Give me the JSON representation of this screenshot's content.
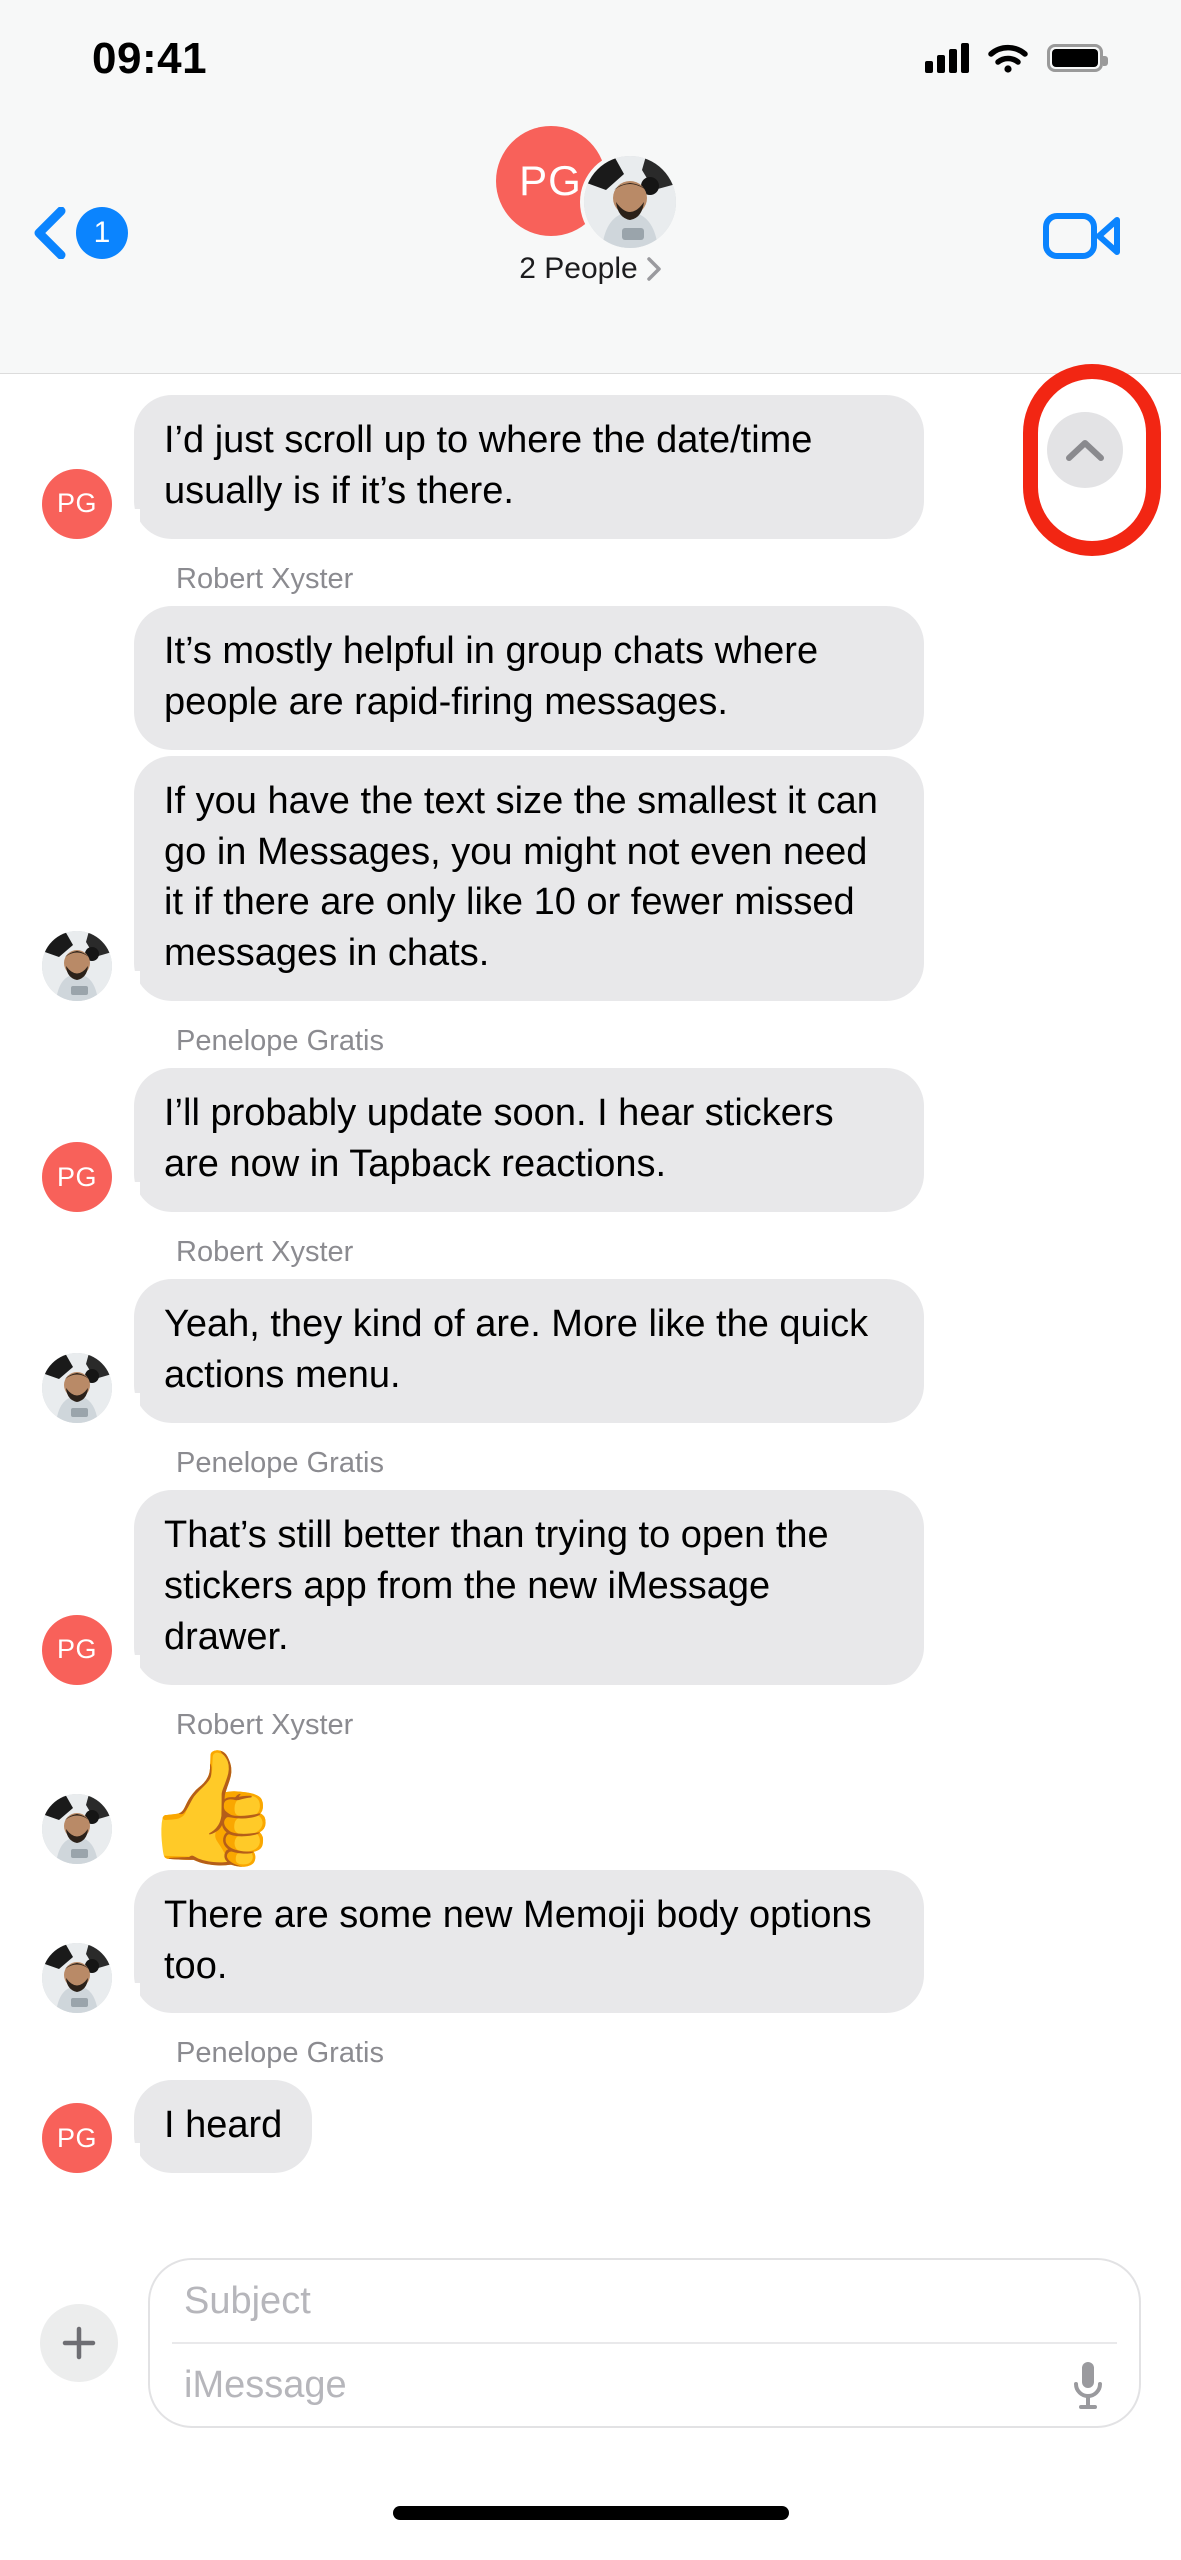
{
  "status_bar": {
    "time": "09:41",
    "cellular_icon": "cellular-signal-icon",
    "wifi_icon": "wifi-icon",
    "battery_icon": "battery-full-icon"
  },
  "nav_bar": {
    "back_icon": "chevron-left-icon",
    "unread_badge": "1",
    "avatar_initials": "PG",
    "avatar_color": "#f8615a",
    "participants_label": "2 People",
    "disclosure_icon": "chevron-right-icon",
    "facetime_icon": "video-camera-icon"
  },
  "scroll_button": {
    "icon": "chevron-up-icon",
    "annotation_color": "#f22613"
  },
  "thread": {
    "messages": [
      {
        "sender": "",
        "show_sender": false,
        "avatar": "PG",
        "avatar_type": "initials",
        "text": "I’d just scroll up to where the date/time usually is if it’s there.",
        "type": "text"
      },
      {
        "sender": "Robert Xyster",
        "show_sender": true,
        "avatar": "",
        "avatar_type": "none",
        "text": "It’s mostly helpful in group chats where people are rapid-firing messages.",
        "type": "text"
      },
      {
        "sender": "",
        "show_sender": false,
        "avatar": "photo",
        "avatar_type": "photo",
        "text": "If you have the text size the smallest it can go in Messages, you might not even need it if there are only like 10 or fewer missed messages in chats.",
        "type": "text"
      },
      {
        "sender": "Penelope Gratis",
        "show_sender": true,
        "avatar": "PG",
        "avatar_type": "initials",
        "text": "I’ll probably update soon. I hear stickers are now in Tapback reactions.",
        "type": "text"
      },
      {
        "sender": "Robert Xyster",
        "show_sender": true,
        "avatar": "photo",
        "avatar_type": "photo",
        "text": "Yeah, they kind of are. More like the quick actions menu.",
        "type": "text"
      },
      {
        "sender": "Penelope Gratis",
        "show_sender": true,
        "avatar": "PG",
        "avatar_type": "initials",
        "text": "That’s still better than trying to open the stickers app from the new iMessage drawer.",
        "type": "text"
      },
      {
        "sender": "Robert Xyster",
        "show_sender": true,
        "avatar": "photo",
        "avatar_type": "photo",
        "text": "👍",
        "type": "emoji"
      },
      {
        "sender": "",
        "show_sender": false,
        "avatar": "photo",
        "avatar_type": "photo",
        "text": "There are some new Memoji body options too.",
        "type": "text"
      },
      {
        "sender": "Penelope Gratis",
        "show_sender": true,
        "avatar": "PG",
        "avatar_type": "initials",
        "text": "I heard",
        "type": "text"
      }
    ]
  },
  "input_bar": {
    "plus_icon": "plus-icon",
    "subject_placeholder": "Subject",
    "message_placeholder": "iMessage",
    "mic_icon": "microphone-icon"
  }
}
